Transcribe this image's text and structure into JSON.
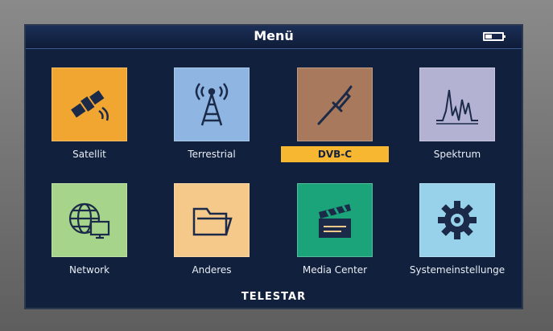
{
  "header": {
    "title": "Menü"
  },
  "brand": "TELESTAR",
  "menu": [
    {
      "label": "Satellit",
      "color": "#f1a632",
      "icon": "satellite-icon"
    },
    {
      "label": "Terrestrial",
      "color": "#8fb6e2",
      "icon": "antenna-tower-icon"
    },
    {
      "label": "DVB-C",
      "color": "#a8795c",
      "icon": "coax-cable-icon",
      "selected": true
    },
    {
      "label": "Spektrum",
      "color": "#b4b2d2",
      "icon": "spectrum-icon"
    },
    {
      "label": "Network",
      "color": "#a6d48b",
      "icon": "network-globe-icon"
    },
    {
      "label": "Anderes",
      "color": "#f4c98a",
      "icon": "folder-icon"
    },
    {
      "label": "Media Center",
      "color": "#1ba47a",
      "icon": "clapperboard-icon"
    },
    {
      "label": "Systemeinstellunge",
      "color": "#97d2ea",
      "icon": "gear-icon"
    }
  ]
}
